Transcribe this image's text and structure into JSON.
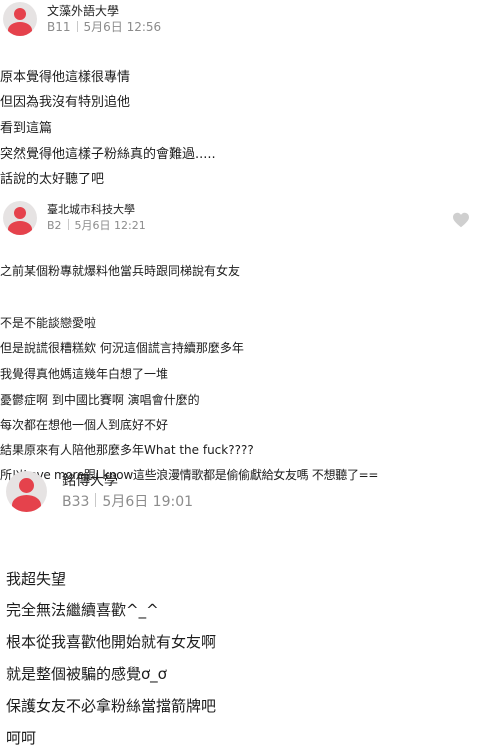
{
  "comments": [
    {
      "school": "文藻外語大學",
      "floor": "B11",
      "time": "5月6日 12:56",
      "lines": [
        "原本覺得他這樣很專情",
        "但因為我沒有特別追他",
        "看到這篇",
        "突然覺得他這樣子粉絲真的會難過.....",
        "話說的太好聽了吧"
      ]
    },
    {
      "school": "臺北城市科技大學",
      "floor": "B2",
      "time": "5月6日 12:21",
      "lines": [
        "之前某個粉專就爆料他當兵時跟同梯說有女友",
        "不是不能談戀愛啦",
        "但是說謊很糟糕欸 何況這個謊言持續那麼多年",
        "我覺得真他媽這幾年白想了一堆",
        "憂鬱症啊 到中國比賽啊 演唱會什麼的",
        "每次都在想他一個人到底好不好",
        "結果原來有人陪他那麼多年What the fuck????",
        "所以Love more跟I know這些浪漫情歌都是偷偷獻給女友嗎 不想聽了=="
      ]
    },
    {
      "school": "銘傳大學",
      "floor": "B33",
      "time": "5月6日 19:01",
      "lines": [
        "我超失望",
        "完全無法繼續喜歡^_^",
        "根本從我喜歡他開始就有女友啊",
        "就是整個被騙的感覺ơ_ơ",
        "保護女友不必拿粉絲當擋箭牌吧",
        "呵呵"
      ]
    }
  ],
  "colors": {
    "avatar_red": "#e5424c",
    "avatar_bg": "#e6e3e3",
    "meta_gray": "#8c8c8c",
    "heart_gray": "#cfcfcf"
  },
  "icons": {
    "avatar": "user-avatar-icon",
    "like": "heart-icon"
  }
}
